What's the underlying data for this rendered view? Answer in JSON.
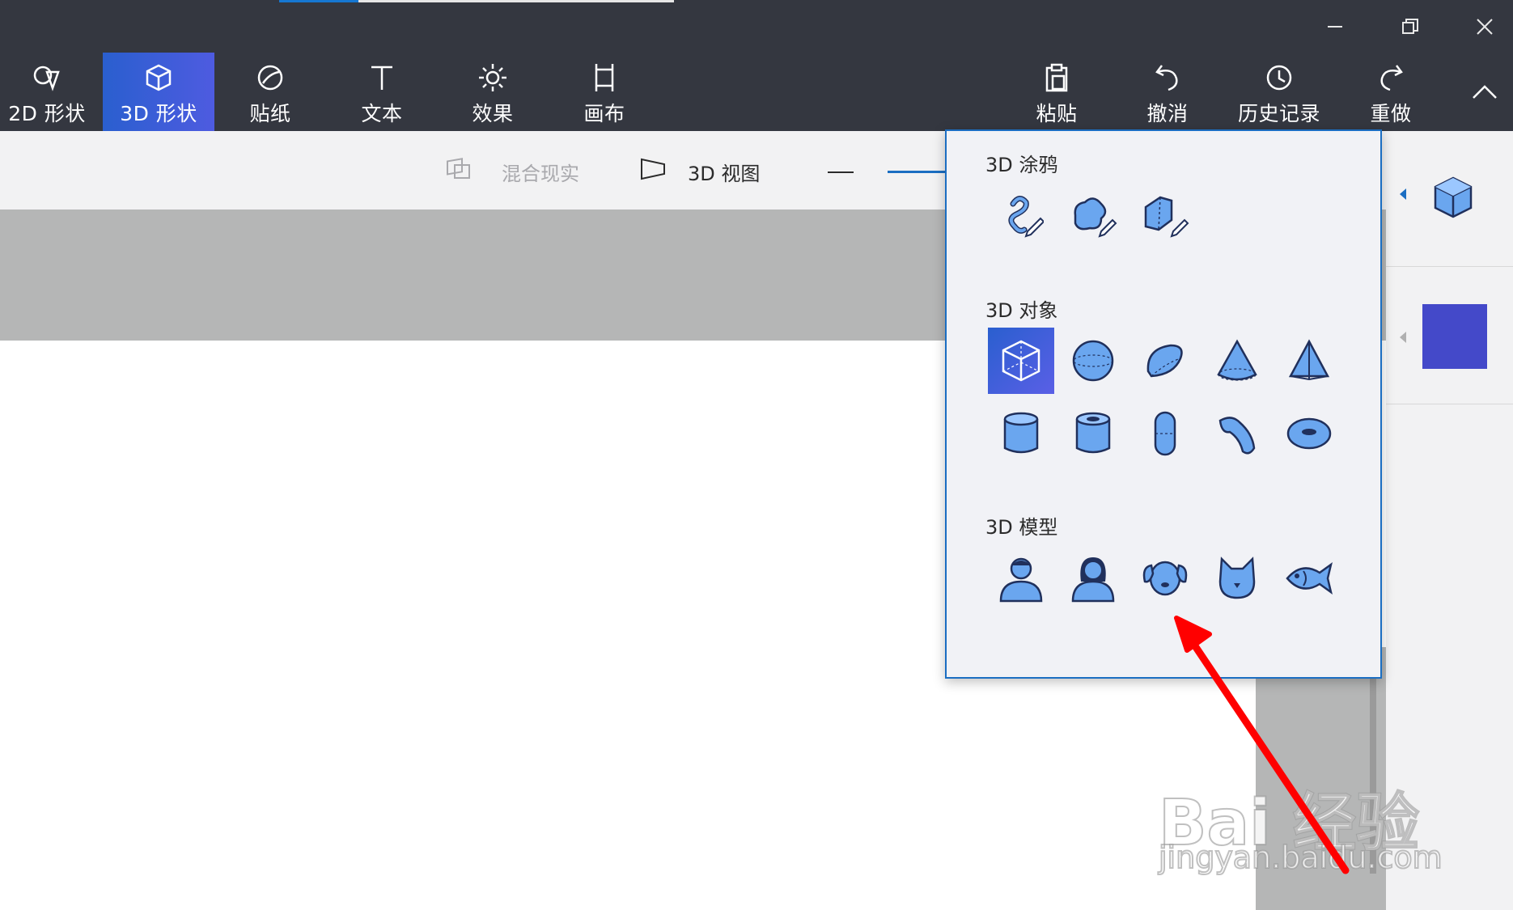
{
  "window": {
    "controls": {
      "minimize": "minimize-icon",
      "restore": "restore-icon",
      "close": "close-icon"
    }
  },
  "ribbon": {
    "tools": [
      {
        "label": "2D 形状",
        "icon": "2d-shapes-icon"
      },
      {
        "label": "3D 形状",
        "icon": "3d-shapes-icon",
        "active": true
      },
      {
        "label": "贴纸",
        "icon": "sticker-icon"
      },
      {
        "label": "文本",
        "icon": "text-icon"
      },
      {
        "label": "效果",
        "icon": "effects-icon"
      },
      {
        "label": "画布",
        "icon": "canvas-icon"
      }
    ],
    "actions": [
      {
        "label": "粘贴",
        "icon": "paste-icon"
      },
      {
        "label": "撤消",
        "icon": "undo-icon"
      },
      {
        "label": "历史记录",
        "icon": "history-icon"
      },
      {
        "label": "重做",
        "icon": "redo-icon"
      }
    ]
  },
  "subbar": {
    "mixed_reality": "混合现实",
    "view_3d": "3D 视图"
  },
  "popup": {
    "doodle_title": "3D 涂鸦",
    "doodles": [
      "sharp-edge-doodle-icon",
      "soft-edge-doodle-icon",
      "tube-doodle-icon"
    ],
    "objects_title": "3D 对象",
    "objects": [
      "cube-icon",
      "sphere-icon",
      "hemisphere-icon",
      "cone-icon",
      "pyramid-icon",
      "cylinder-icon",
      "tube-icon",
      "capsule-icon",
      "curved-pipe-icon",
      "donut-icon"
    ],
    "models_title": "3D 模型",
    "models": [
      "man-icon",
      "woman-icon",
      "dog-icon",
      "cat-icon",
      "fish-icon"
    ]
  },
  "colors": {
    "accent": "#1b6ec2",
    "selected_swatch": "#4449c9",
    "annotation_arrow": "#ff0000"
  },
  "watermark": {
    "brand": "Bai 经验",
    "url": "jingyan.baidu.com"
  }
}
